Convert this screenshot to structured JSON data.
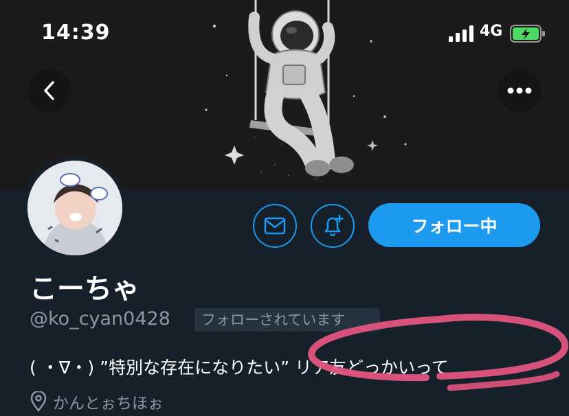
{
  "status_bar": {
    "time": "14:39",
    "network": "4G"
  },
  "profile": {
    "display_name": "こーちゃ",
    "handle": "@ko_cyan0428",
    "follows_you_badge": "フォローされています",
    "bio": "( ・∇・) ”特別な存在になりたい” リア友どっかいって",
    "location": "かんとぉちほぉ"
  },
  "actions": {
    "follow_label": "フォロー中"
  },
  "icons": {
    "back": "chevron-left-icon",
    "more": "ellipsis-icon",
    "mail": "mail-icon",
    "notify": "bell-plus-icon",
    "location": "location-pin-icon"
  },
  "colors": {
    "background": "#15202b",
    "accent": "#1d9bf0",
    "secondary_text": "#8899a6",
    "badge_bg": "#253341",
    "annotation": "#e0557e",
    "battery": "#4cd964"
  }
}
